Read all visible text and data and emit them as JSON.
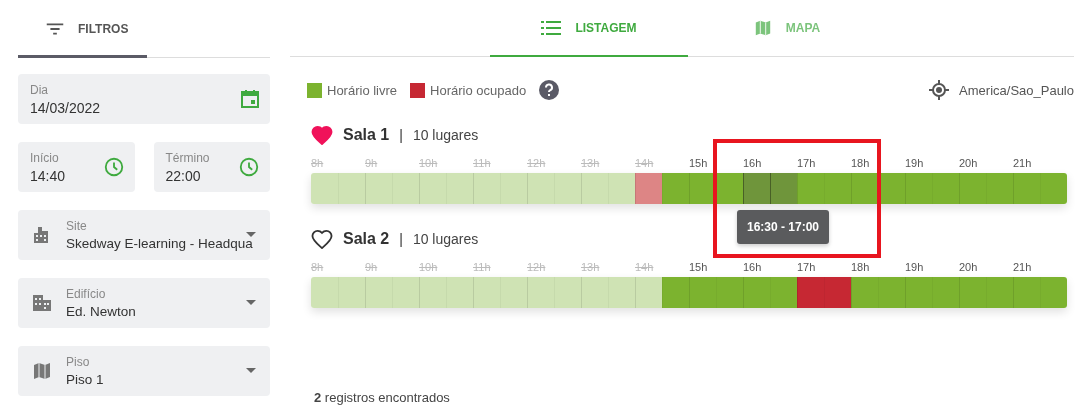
{
  "filters_tab": {
    "label": "FILTROS",
    "selected": true
  },
  "fields": [
    {
      "kind": "date",
      "label": "Dia",
      "value": "14/03/2022"
    },
    {
      "kind": "time",
      "label": "Início",
      "value": "14:40"
    },
    {
      "kind": "time",
      "label": "Término",
      "value": "22:00"
    },
    {
      "kind": "select",
      "label": "Site",
      "value": "Skedway E-learning - Headqua"
    },
    {
      "kind": "select",
      "label": "Edifício",
      "value": "Ed. Newton"
    },
    {
      "kind": "select",
      "label": "Piso",
      "value": "Piso 1"
    }
  ],
  "tabs": [
    {
      "label": "LISTAGEM",
      "selected": true
    },
    {
      "label": "MAPA",
      "selected": false
    }
  ],
  "legend": [
    {
      "label": "Horário livre",
      "color": "#7cb32f"
    },
    {
      "label": "Horário ocupado",
      "color": "#c62833"
    }
  ],
  "timezone": "America/Sao_Paulo",
  "rooms": [
    {
      "name": "Sala 1",
      "separator": "|",
      "capacity": "10 lugares",
      "favorite": true,
      "highlight_frame": true,
      "tooltip": "16:30 - 17:00",
      "hours": [
        {
          "label": "8h",
          "past": true
        },
        {
          "label": "9h",
          "past": true
        },
        {
          "label": "10h",
          "past": true
        },
        {
          "label": "11h",
          "past": true
        },
        {
          "label": "12h",
          "past": true
        },
        {
          "label": "13h",
          "past": true
        },
        {
          "label": "14h",
          "past": true
        },
        {
          "label": "15h",
          "past": false
        },
        {
          "label": "16h",
          "past": false
        },
        {
          "label": "17h",
          "past": false
        },
        {
          "label": "18h",
          "past": false
        },
        {
          "label": "19h",
          "past": false
        },
        {
          "label": "20h",
          "past": false
        },
        {
          "label": "21h",
          "past": false
        }
      ],
      "slots": [
        {
          "past": true,
          "busy": false,
          "hovered": false
        },
        {
          "past": true,
          "busy": false,
          "hovered": false
        },
        {
          "past": true,
          "busy": false,
          "hovered": false
        },
        {
          "past": true,
          "busy": false,
          "hovered": false
        },
        {
          "past": true,
          "busy": false,
          "hovered": false
        },
        {
          "past": true,
          "busy": false,
          "hovered": false
        },
        {
          "past": true,
          "busy": false,
          "hovered": false
        },
        {
          "past": true,
          "busy": false,
          "hovered": false
        },
        {
          "past": true,
          "busy": false,
          "hovered": false
        },
        {
          "past": true,
          "busy": false,
          "hovered": false
        },
        {
          "past": true,
          "busy": false,
          "hovered": false
        },
        {
          "past": true,
          "busy": false,
          "hovered": false
        },
        {
          "past": true,
          "busy": true,
          "hovered": false
        },
        {
          "past": false,
          "busy": false,
          "hovered": false
        },
        {
          "past": false,
          "busy": false,
          "hovered": false
        },
        {
          "past": false,
          "busy": false,
          "hovered": false
        },
        {
          "past": false,
          "busy": false,
          "hovered": true
        },
        {
          "past": false,
          "busy": false,
          "hovered": true
        },
        {
          "past": false,
          "busy": false,
          "hovered": false
        },
        {
          "past": false,
          "busy": false,
          "hovered": false
        },
        {
          "past": false,
          "busy": false,
          "hovered": false
        },
        {
          "past": false,
          "busy": false,
          "hovered": false
        },
        {
          "past": false,
          "busy": false,
          "hovered": false
        },
        {
          "past": false,
          "busy": false,
          "hovered": false
        },
        {
          "past": false,
          "busy": false,
          "hovered": false
        },
        {
          "past": false,
          "busy": false,
          "hovered": false
        },
        {
          "past": false,
          "busy": false,
          "hovered": false
        },
        {
          "past": false,
          "busy": false,
          "hovered": false
        }
      ]
    },
    {
      "name": "Sala 2",
      "separator": "|",
      "capacity": "10 lugares",
      "favorite": false,
      "hours": [
        {
          "label": "8h",
          "past": true
        },
        {
          "label": "9h",
          "past": true
        },
        {
          "label": "10h",
          "past": true
        },
        {
          "label": "11h",
          "past": true
        },
        {
          "label": "12h",
          "past": true
        },
        {
          "label": "13h",
          "past": true
        },
        {
          "label": "14h",
          "past": true
        },
        {
          "label": "15h",
          "past": false
        },
        {
          "label": "16h",
          "past": false
        },
        {
          "label": "17h",
          "past": false
        },
        {
          "label": "18h",
          "past": false
        },
        {
          "label": "19h",
          "past": false
        },
        {
          "label": "20h",
          "past": false
        },
        {
          "label": "21h",
          "past": false
        }
      ],
      "slots": [
        {
          "past": true,
          "busy": false,
          "hovered": false
        },
        {
          "past": true,
          "busy": false,
          "hovered": false
        },
        {
          "past": true,
          "busy": false,
          "hovered": false
        },
        {
          "past": true,
          "busy": false,
          "hovered": false
        },
        {
          "past": true,
          "busy": false,
          "hovered": false
        },
        {
          "past": true,
          "busy": false,
          "hovered": false
        },
        {
          "past": true,
          "busy": false,
          "hovered": false
        },
        {
          "past": true,
          "busy": false,
          "hovered": false
        },
        {
          "past": true,
          "busy": false,
          "hovered": false
        },
        {
          "past": true,
          "busy": false,
          "hovered": false
        },
        {
          "past": true,
          "busy": false,
          "hovered": false
        },
        {
          "past": true,
          "busy": false,
          "hovered": false
        },
        {
          "past": true,
          "busy": false,
          "hovered": false
        },
        {
          "past": false,
          "busy": false,
          "hovered": false
        },
        {
          "past": false,
          "busy": false,
          "hovered": false
        },
        {
          "past": false,
          "busy": false,
          "hovered": false
        },
        {
          "past": false,
          "busy": false,
          "hovered": false
        },
        {
          "past": false,
          "busy": false,
          "hovered": false
        },
        {
          "past": false,
          "busy": true,
          "hovered": false
        },
        {
          "past": false,
          "busy": true,
          "hovered": false
        },
        {
          "past": false,
          "busy": false,
          "hovered": false
        },
        {
          "past": false,
          "busy": false,
          "hovered": false
        },
        {
          "past": false,
          "busy": false,
          "hovered": false
        },
        {
          "past": false,
          "busy": false,
          "hovered": false
        },
        {
          "past": false,
          "busy": false,
          "hovered": false
        },
        {
          "past": false,
          "busy": false,
          "hovered": false
        },
        {
          "past": false,
          "busy": false,
          "hovered": false
        },
        {
          "past": false,
          "busy": false,
          "hovered": false
        }
      ]
    }
  ],
  "records": {
    "count": "2",
    "text": "registros encontrados"
  }
}
